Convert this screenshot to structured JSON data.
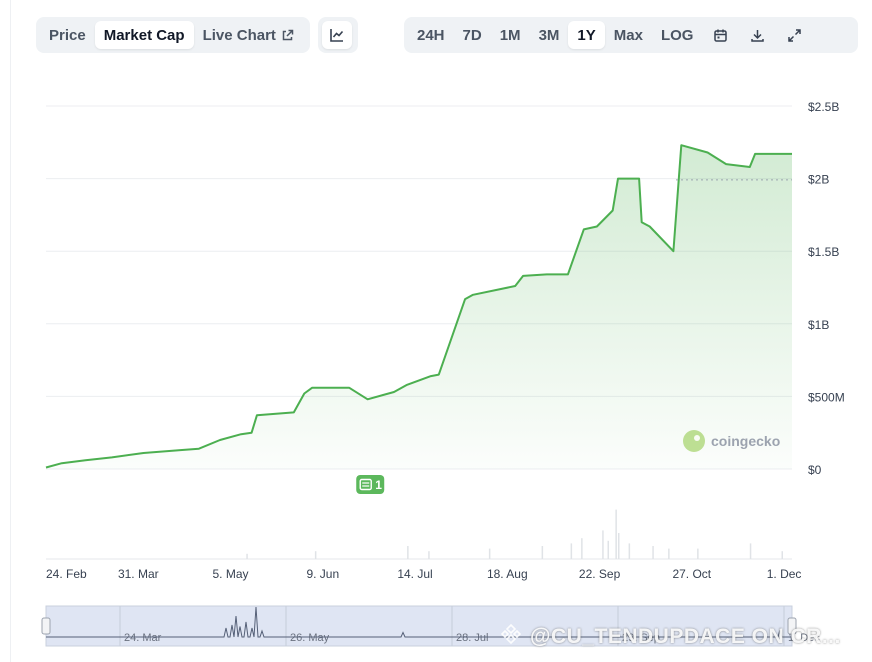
{
  "toolbar": {
    "price_label": "Price",
    "market_cap_label": "Market Cap",
    "live_chart_label": "Live Chart",
    "chart_icon": "line-chart-icon",
    "ranges": [
      "24H",
      "7D",
      "1M",
      "3M",
      "1Y",
      "Max",
      "LOG"
    ],
    "active_range": "1Y",
    "active_tab": "Market Cap",
    "calendar_icon": "calendar-icon",
    "download_icon": "download-icon",
    "fullscreen_icon": "fullscreen-icon"
  },
  "chart_data": {
    "type": "area",
    "title": "",
    "xlabel": "",
    "ylabel": "",
    "ylim": [
      0,
      2500000000
    ],
    "y_tick_values": [
      0,
      500000000,
      1000000000,
      1500000000,
      2000000000,
      2500000000
    ],
    "y_tick_labels": [
      "$0",
      "$500M",
      "$1B",
      "$1.5B",
      "$2B",
      "$2.5B"
    ],
    "x_tick_labels": [
      "24. Feb",
      "31. Mar",
      "5. May",
      "9. Jun",
      "14. Jul",
      "18. Aug",
      "22. Sep",
      "27. Oct",
      "1. Dec"
    ],
    "grid": true,
    "series": [
      {
        "color": "#4caf50",
        "x": [
          "2024-02-24",
          "2024-03-01",
          "2024-03-10",
          "2024-03-20",
          "2024-04-01",
          "2024-04-15",
          "2024-04-22",
          "2024-04-30",
          "2024-05-08",
          "2024-05-12",
          "2024-05-14",
          "2024-05-28",
          "2024-06-01",
          "2024-06-04",
          "2024-06-18",
          "2024-06-25",
          "2024-07-05",
          "2024-07-10",
          "2024-07-19",
          "2024-07-22",
          "2024-08-01",
          "2024-08-04",
          "2024-08-20",
          "2024-08-23",
          "2024-09-01",
          "2024-09-09",
          "2024-09-15",
          "2024-09-20",
          "2024-09-26",
          "2024-09-28",
          "2024-10-06",
          "2024-10-07",
          "2024-10-10",
          "2024-10-19",
          "2024-10-22",
          "2024-11-01",
          "2024-11-08",
          "2024-11-17",
          "2024-11-19",
          "2024-12-03"
        ],
        "values": [
          10000000,
          40000000,
          60000000,
          80000000,
          110000000,
          130000000,
          140000000,
          200000000,
          240000000,
          250000000,
          370000000,
          390000000,
          520000000,
          560000000,
          560000000,
          480000000,
          530000000,
          580000000,
          640000000,
          650000000,
          1170000000,
          1200000000,
          1260000000,
          1330000000,
          1340000000,
          1340000000,
          1650000000,
          1670000000,
          1780000000,
          2000000000,
          2000000000,
          1700000000,
          1670000000,
          1500000000,
          2230000000,
          2180000000,
          2100000000,
          2080000000,
          2170000000,
          2170000000
        ]
      }
    ],
    "volume": {
      "x": [
        "2024-05-10",
        "2024-06-05",
        "2024-07-10",
        "2024-07-18",
        "2024-08-10",
        "2024-08-30",
        "2024-09-10",
        "2024-09-14",
        "2024-09-22",
        "2024-09-24",
        "2024-09-27",
        "2024-09-28",
        "2024-10-02",
        "2024-10-11",
        "2024-10-17",
        "2024-10-28",
        "2024-11-17",
        "2024-11-29"
      ],
      "relative": [
        0.1,
        0.15,
        0.25,
        0.15,
        0.2,
        0.25,
        0.3,
        0.4,
        0.55,
        0.35,
        0.95,
        0.5,
        0.3,
        0.25,
        0.2,
        0.2,
        0.3,
        0.15
      ]
    },
    "annotations": [
      {
        "label": "1",
        "icon": "news-icon",
        "x": "2024-06-26"
      }
    ],
    "navigator": {
      "x_tick_labels": [
        "24. Mar",
        "26. May",
        "28. Jul",
        "29. Sep",
        "1. Dec"
      ]
    },
    "logo_text": "coingecko"
  },
  "watermark": {
    "text": "@CU_TENDUPDACE ON CR..."
  }
}
